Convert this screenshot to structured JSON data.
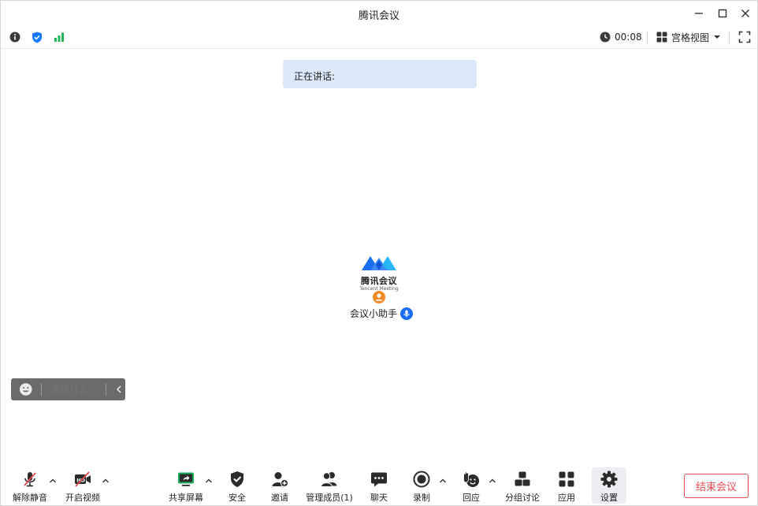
{
  "window": {
    "title": "腾讯会议"
  },
  "status": {
    "timer": "00:08",
    "view_mode": "宫格视图"
  },
  "speaking": {
    "label": "正在讲话:"
  },
  "brand": {
    "name_cn": "腾讯会议",
    "name_en": "Tencent Meeting"
  },
  "participant": {
    "name": "会议小助手"
  },
  "chat": {
    "placeholder": "说点什么..."
  },
  "toolbar": {
    "unmute": "解除静音",
    "start_video": "开启视频",
    "share_screen": "共享屏幕",
    "security": "安全",
    "invite": "邀请",
    "manage_members": "管理成员(1)",
    "chat": "聊天",
    "record": "录制",
    "reactions": "回应",
    "breakout": "分组讨论",
    "apps": "应用",
    "settings": "设置",
    "end_meeting": "结束会议"
  },
  "colors": {
    "brand_blue": "#1a6ef5",
    "shield_blue": "#1677ff",
    "signal_green": "#21b35a",
    "end_red": "#e5484d",
    "speaking_bg": "#dce9fb",
    "share_green": "#1aad5c",
    "avatar_orange": "#f08a24"
  }
}
